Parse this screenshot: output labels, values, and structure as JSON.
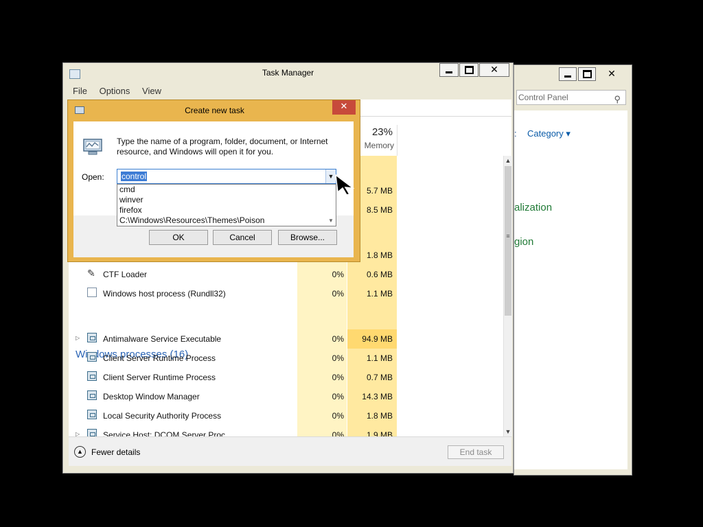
{
  "control_panel": {
    "search_placeholder": "Control Panel",
    "view_colon": ":",
    "category_label": "Category",
    "category_arrow": "▾",
    "link1": "alization",
    "link2": "gion"
  },
  "task_manager": {
    "title": "Task Manager",
    "menu": [
      "File",
      "Options",
      "View"
    ],
    "memory_percent": "23%",
    "memory_label": "Memory",
    "rows": [
      {
        "name": "",
        "cpu": "",
        "mem": "5.7 MB"
      },
      {
        "name": "",
        "cpu": "",
        "mem": "8.5 MB"
      },
      {
        "name": "",
        "cpu": "",
        "mem": "1.8 MB"
      },
      {
        "name": "CTF Loader",
        "cpu": "0%",
        "mem": "0.6 MB"
      },
      {
        "name": "Windows host process (Rundll32)",
        "cpu": "0%",
        "mem": "1.1 MB"
      }
    ],
    "section_title": "Windows processes (16)",
    "windows_processes": [
      {
        "name": "Antimalware Service Executable",
        "cpu": "0%",
        "mem": "94.9 MB"
      },
      {
        "name": "Client Server Runtime Process",
        "cpu": "0%",
        "mem": "1.1 MB"
      },
      {
        "name": "Client Server Runtime Process",
        "cpu": "0%",
        "mem": "0.7 MB"
      },
      {
        "name": "Desktop Window Manager",
        "cpu": "0%",
        "mem": "14.3 MB"
      },
      {
        "name": "Local Security Authority Process",
        "cpu": "0%",
        "mem": "1.8 MB"
      },
      {
        "name": "Service Host: DCOM Server Proc...",
        "cpu": "0%",
        "mem": "1.9 MB"
      }
    ],
    "fewer_details": "Fewer details",
    "end_task": "End task"
  },
  "dialog": {
    "title": "Create new task",
    "close_glyph": "✕",
    "message": "Type the name of a program, folder, document, or Internet resource, and Windows will open it for you.",
    "open_label": "Open:",
    "combo_value": "control",
    "options": [
      "cmd",
      "winver",
      "firefox",
      "C:\\Windows\\Resources\\Themes\\Poison"
    ],
    "ok_label": "OK",
    "cancel_label": "Cancel",
    "browse_label": "Browse..."
  },
  "colors": {
    "dialog_frame": "#e9b54e",
    "close_red": "#c74a3b",
    "selection_blue": "#3d7cd5",
    "cpu_column": "#fff4c4",
    "memory_column": "#ffe9a0",
    "section_blue": "#2a64b5",
    "link_green": "#207a36"
  }
}
